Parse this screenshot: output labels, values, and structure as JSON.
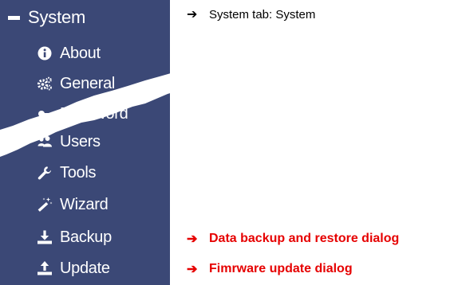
{
  "sidebar": {
    "header": {
      "label": "System",
      "icon": "minus-icon"
    },
    "items": [
      {
        "label": "About",
        "icon": "info-circle-icon"
      },
      {
        "label": "General",
        "icon": "cogs-icon"
      },
      {
        "label": "Password",
        "icon": "key-icon"
      },
      {
        "label": "Users",
        "icon": "users-icon"
      },
      {
        "label": "Tools",
        "icon": "wrench-icon"
      },
      {
        "label": "Wizard",
        "icon": "magic-wand-icon"
      },
      {
        "label": "Backup",
        "icon": "download-icon"
      },
      {
        "label": "Update",
        "icon": "upload-icon"
      }
    ],
    "background_color": "#3b4876"
  },
  "annotations": [
    {
      "arrow": "➔",
      "text": "System tab: System",
      "color": "#000000"
    },
    {
      "arrow": "➔",
      "text": "Data backup and restore dialog",
      "color": "#e60000"
    },
    {
      "arrow": "➔",
      "text": "Fimrware update dialog",
      "color": "#e60000"
    }
  ]
}
